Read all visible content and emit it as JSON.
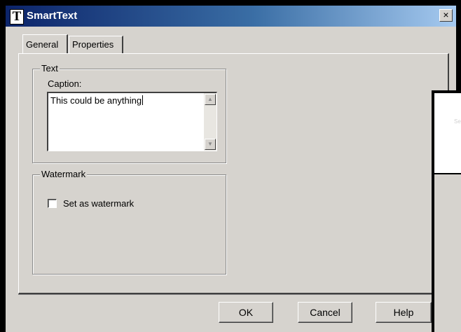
{
  "window": {
    "title": "SmartText",
    "app_icon_glyph": "T",
    "close_glyph": "×"
  },
  "tabs": [
    {
      "label": "General",
      "selected": true
    },
    {
      "label": "Properties",
      "selected": false
    }
  ],
  "text_group": {
    "legend": "Text",
    "caption_label": "Caption:",
    "caption_value": "This could be anything",
    "scroll_up_glyph": "▲",
    "scroll_down_glyph": "▼"
  },
  "watermark_group": {
    "legend": "Watermark",
    "checkbox_label": "Set as watermark",
    "checked": false
  },
  "buttons": {
    "ok": "OK",
    "cancel": "Cancel",
    "help": "Help"
  },
  "overlay": {
    "hint": "Se"
  },
  "colors": {
    "dialog_bg": "#d6d3ce",
    "title_start": "#0c246a",
    "title_end": "#a6caf0"
  }
}
